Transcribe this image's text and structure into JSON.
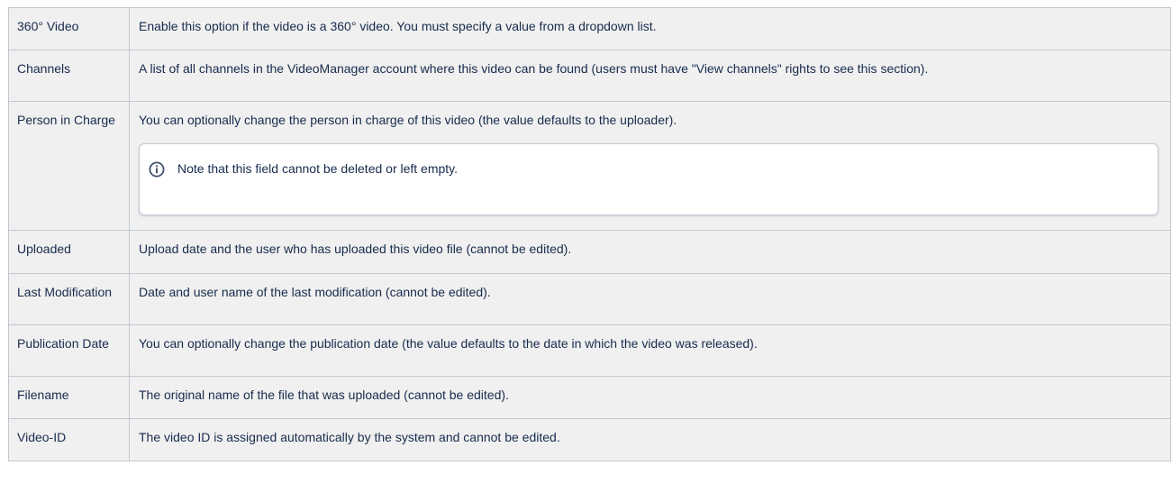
{
  "rows": [
    {
      "label": "360° Video",
      "description": "Enable this option if the video is a 360° video. You must specify a value from a dropdown list."
    },
    {
      "label": "Channels",
      "description": "A list of all channels in the VideoManager account where this video can be found (users must have \"View channels\" rights to see this section)."
    },
    {
      "label": "Person in Charge",
      "description": "You can optionally change the person in charge of this video (the value defaults to the uploader).",
      "note": {
        "icon": "info-icon",
        "text": "Note that this field cannot be deleted or left empty."
      }
    },
    {
      "label": "Uploaded",
      "description": "Upload date and the user who has uploaded this video file (cannot be edited)."
    },
    {
      "label": "Last Modification",
      "description": "Date and user name of the last modification (cannot be edited)."
    },
    {
      "label": "Publication Date",
      "description": "You can optionally change the publication date (the value defaults to the date in which the video was released)."
    },
    {
      "label": "Filename",
      "description": "The original name of the file that was uploaded (cannot be edited)."
    },
    {
      "label": "Video-ID",
      "description": "The video ID is assigned automatically by the system and cannot be edited."
    }
  ],
  "colors": {
    "cell_background": "#f0f0f0",
    "border": "#c1c7d0",
    "text": "#172b4d",
    "note_background": "#ffffff",
    "info_icon": "#42526e"
  }
}
